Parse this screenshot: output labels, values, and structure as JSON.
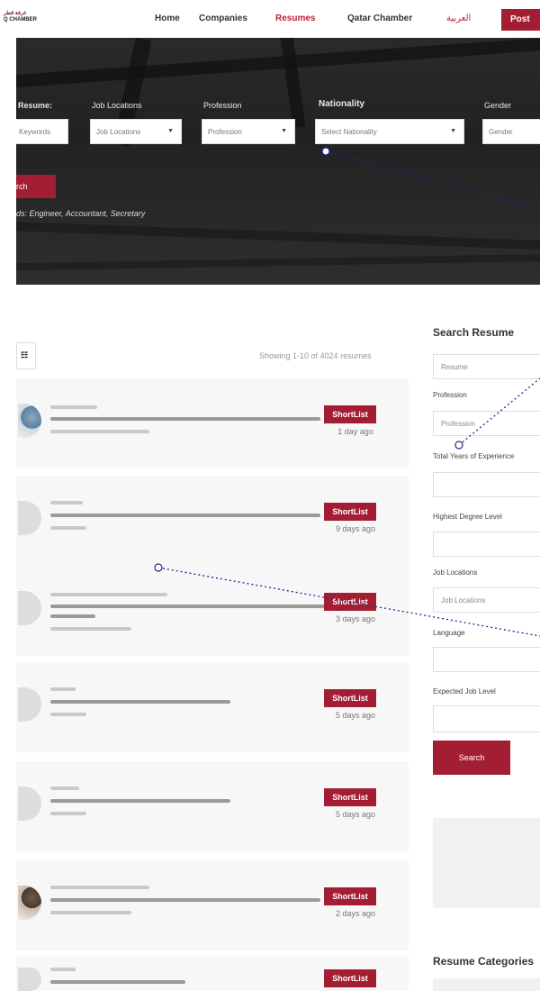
{
  "header": {
    "logo_line1": "غرفة قطر",
    "logo_line2": "Q CHAMBER",
    "nav": [
      {
        "label": "Home"
      },
      {
        "label": "Companies"
      },
      {
        "label": "Resumes"
      },
      {
        "label": "Qatar Chamber"
      },
      {
        "label": "العربية"
      }
    ],
    "post_label": "Post"
  },
  "hero": {
    "labels": {
      "resume": "Resume:",
      "job_locations": "Job Locations",
      "profession": "Profession",
      "nationality": "Nationality",
      "gender": "Gender"
    },
    "fields": {
      "keywords_placeholder": "Keywords",
      "job_locations_value": "Job Locations",
      "profession_value": "Profession",
      "nationality_value": "Select Nationality",
      "gender_value": "Gender"
    },
    "search_label": "rch",
    "keywords_text": "ds: Engineer, Accountant, Secretary"
  },
  "listing": {
    "view_icon_text": "☷",
    "showing": "Showing 1-10 of 4024 resumes",
    "cards": [
      {
        "shortlist": "ShortList",
        "ago": "1 day ago"
      },
      {
        "shortlist": "ShortList",
        "ago": "9 days ago"
      },
      {
        "shortlist": "ShortList",
        "ago": "3 days ago"
      },
      {
        "shortlist": "ShortList",
        "ago": "5 days ago"
      },
      {
        "shortlist": "ShortList",
        "ago": "5 days ago"
      },
      {
        "shortlist": "ShortList",
        "ago": "2 days ago"
      },
      {
        "shortlist": "ShortList",
        "ago": ""
      }
    ]
  },
  "sidebar": {
    "title": "Search Resume",
    "keywords_placeholder": "Resume",
    "profession_label": "Profession",
    "profession_value": "Profession",
    "experience_label": "Total Years of Experience",
    "degree_label": "Highest Degree Level",
    "job_locations_label": "Job Locations",
    "job_locations_value": "Job Locations",
    "language_label": "Language",
    "expected_label": "Expected Job Level",
    "search_label": "Search",
    "categories_title": "Resume Categories"
  },
  "colors": {
    "brand": "#a31d33",
    "active_nav": "#b8233f"
  }
}
